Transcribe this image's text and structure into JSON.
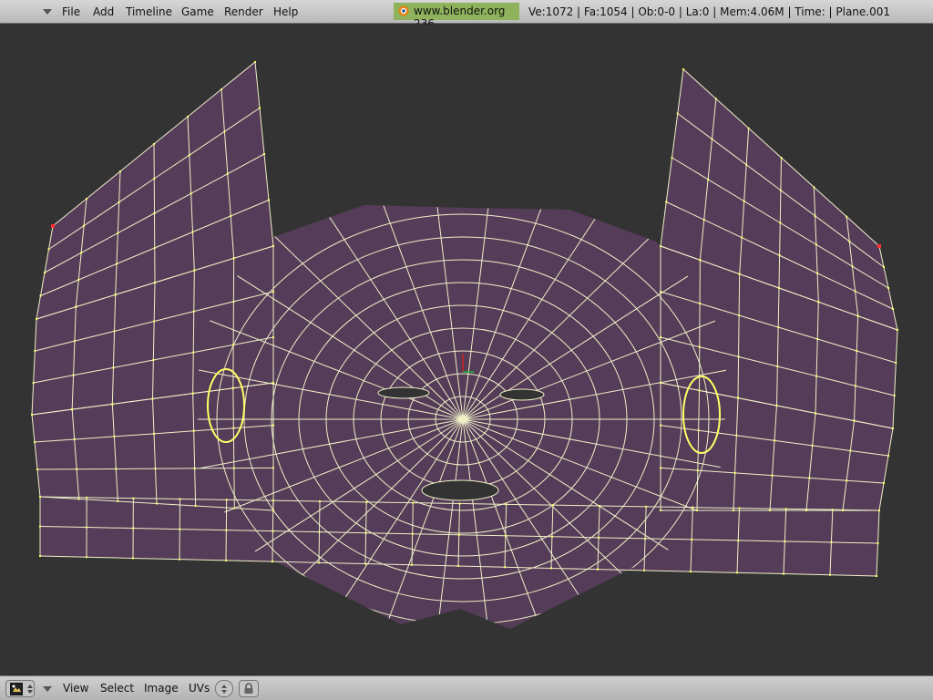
{
  "topbar": {
    "menu": [
      "File",
      "Add",
      "Timeline",
      "Game",
      "Render",
      "Help"
    ],
    "url": "www.blender.org 236",
    "stats": "Ve:1072 | Fa:1054 | Ob:0-0 | La:0 | Mem:4.06M | Time: | Plane.001",
    "badge_color": "#8fb35c"
  },
  "viewport": {
    "background": "#333333",
    "face_color": "#553c58",
    "edge_color": "#f0f0c8",
    "vertex_color": "#ffff66"
  },
  "bottombar": {
    "menu": [
      "View",
      "Select",
      "Image",
      "UVs"
    ]
  }
}
